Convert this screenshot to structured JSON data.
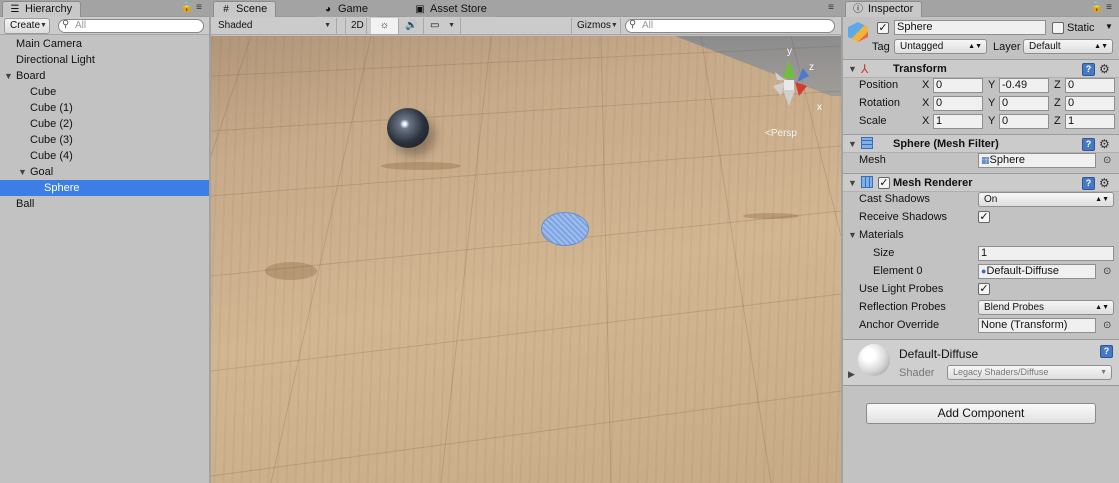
{
  "hierarchy": {
    "tab": "Hierarchy",
    "create": "Create",
    "search_placeholder": "All",
    "items": [
      {
        "label": "Main Camera"
      },
      {
        "label": "Directional Light"
      },
      {
        "label": "Board"
      },
      {
        "label": "Cube"
      },
      {
        "label": "Cube (1)"
      },
      {
        "label": "Cube (2)"
      },
      {
        "label": "Cube (3)"
      },
      {
        "label": "Cube (4)"
      },
      {
        "label": "Goal"
      },
      {
        "label": "Sphere"
      },
      {
        "label": "Ball"
      }
    ]
  },
  "scene": {
    "tabs": [
      {
        "label": "Scene"
      },
      {
        "label": "Game"
      },
      {
        "label": "Asset Store"
      }
    ],
    "shading": "Shaded",
    "mode_2d": "2D",
    "gizmos": "Gizmos",
    "search_placeholder": "All",
    "gizmo_axes": {
      "y": "y",
      "z": "z",
      "x": "x"
    },
    "persp": "Persp"
  },
  "inspector": {
    "tab": "Inspector",
    "name": "Sphere",
    "static_label": "Static",
    "tag_label": "Tag",
    "tag_value": "Untagged",
    "layer_label": "Layer",
    "layer_value": "Default",
    "transform": {
      "title": "Transform",
      "position_label": "Position",
      "rotation_label": "Rotation",
      "scale_label": "Scale",
      "axis_x": "X",
      "axis_y": "Y",
      "axis_z": "Z",
      "position": {
        "x": "0",
        "y": "-0.49",
        "z": "0"
      },
      "rotation": {
        "x": "0",
        "y": "0",
        "z": "0"
      },
      "scale": {
        "x": "1",
        "y": "0",
        "z": "1"
      }
    },
    "mesh_filter": {
      "title": "Sphere (Mesh Filter)",
      "mesh_label": "Mesh",
      "mesh_value": "Sphere"
    },
    "mesh_renderer": {
      "title": "Mesh Renderer",
      "cast_shadows_label": "Cast Shadows",
      "cast_shadows_value": "On",
      "receive_shadows_label": "Receive Shadows",
      "materials_label": "Materials",
      "size_label": "Size",
      "size_value": "1",
      "element0_label": "Element 0",
      "element0_value": "Default-Diffuse",
      "light_probes_label": "Use Light Probes",
      "reflection_probes_label": "Reflection Probes",
      "reflection_probes_value": "Blend Probes",
      "anchor_label": "Anchor Override",
      "anchor_value": "None (Transform)"
    },
    "material": {
      "name": "Default-Diffuse",
      "shader_label": "Shader",
      "shader_value": "Legacy Shaders/Diffuse"
    },
    "add_component": "Add Component"
  }
}
